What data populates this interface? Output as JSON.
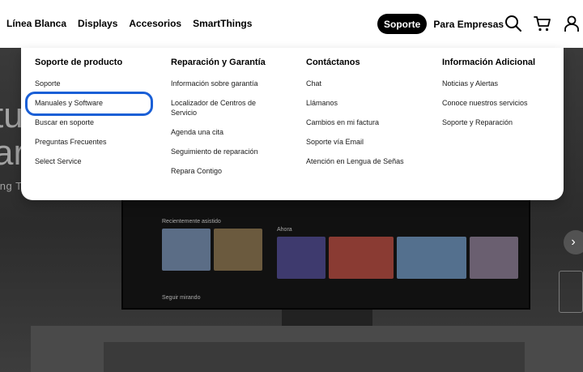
{
  "header": {
    "nav_left": [
      "Línea Blanca",
      "Displays",
      "Accesorios",
      "SmartThings"
    ],
    "nav_active": "Soporte",
    "nav_business": "Para Empresas",
    "icons": [
      "search-icon",
      "cart-icon",
      "user-icon"
    ]
  },
  "menu": {
    "columns": [
      {
        "title": "Soporte de producto",
        "items": [
          "Soporte",
          "Manuales y Software",
          "Buscar en soporte",
          "Preguntas Frecuentes",
          "Select Service"
        ]
      },
      {
        "title": "Reparación y Garantía",
        "items": [
          "Información sobre garantía",
          "Localizador de Centros de Servicio",
          "Agenda una cita",
          "Seguimiento de reparación",
          "Repara Contigo"
        ]
      },
      {
        "title": "Contáctanos",
        "items": [
          "Chat",
          "Llámanos",
          "Cambios en mi factura",
          "Soporte vía Email",
          "Atención en Lengua de Señas"
        ]
      },
      {
        "title": "Información Adicional",
        "items": [
          "Noticias y Alertas",
          "Conoce nuestros servicios",
          "Soporte y Reparación"
        ]
      }
    ],
    "highlight_color": "#1a5fd6"
  },
  "hero": {
    "fragments": [
      "tu",
      "ar",
      "ung T"
    ],
    "tv_labels": [
      "Recientemente asistido",
      "Ahora",
      "Seguir mirando"
    ]
  }
}
